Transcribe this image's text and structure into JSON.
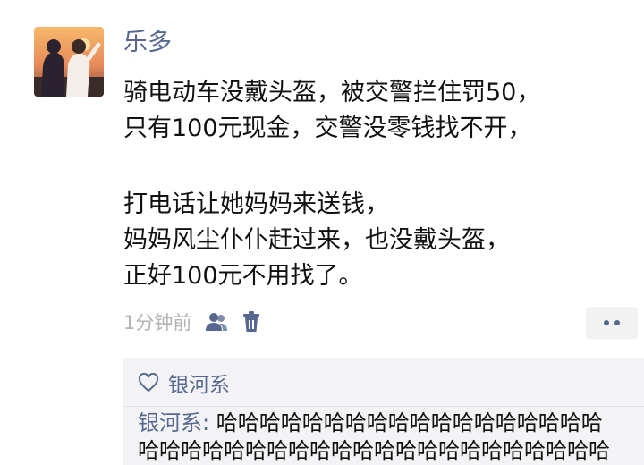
{
  "post": {
    "author": "乐多",
    "paragraphs": [
      [
        "骑电动车没戴头盔，被交警拦住罚50，",
        "只有100元现金，交警没零钱找不开，"
      ],
      [
        "打电话让她妈妈来送钱，",
        "妈妈风尘仆仆赶过来，也没戴头盔，",
        "正好100元不用找了。"
      ]
    ],
    "timestamp": "1分钟前"
  },
  "icons": {
    "visibility": "people-icon",
    "delete": "trash-icon",
    "more": "more-dots-icon",
    "like": "heart-outline-icon"
  },
  "likes": {
    "names": "银河系"
  },
  "comment": {
    "commenter": "银河系",
    "separator": ": ",
    "line1": "哈哈哈哈哈哈哈哈哈哈哈哈哈哈哈哈哈哈",
    "line2": "哈哈哈哈哈哈哈哈哈哈哈哈哈哈哈哈哈哈哈哈哈哈"
  },
  "colors": {
    "link": "#56688f",
    "muted": "#b2b2b2",
    "panel": "#f3f3f5"
  }
}
